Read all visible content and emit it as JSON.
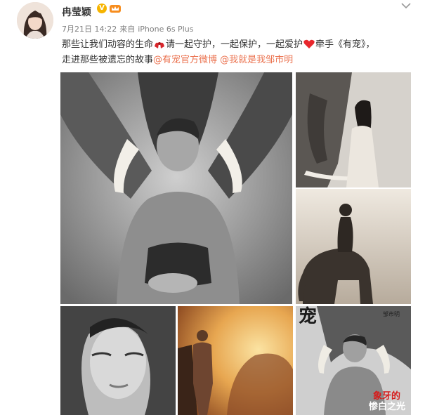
{
  "post": {
    "username": "冉莹颖",
    "verified_badge": "V",
    "timestamp": "7月21日 14:22",
    "source_prefix": "来自",
    "source_device": "iPhone 6s Plus",
    "text_part1": "那些让我们动容的生命",
    "text_part2": "请一起守护，一起保护，一起爱护",
    "text_part3": "牵手《有宠》，",
    "text_part4": "走进那些被遗忘的故事",
    "mention_1": "@有宠官方微博",
    "mention_2": "@我就是我邹市明"
  },
  "icons": {
    "avatar": "avatar",
    "verified": "verified-v-icon",
    "member": "crown-icon",
    "menu": "chevron-down-icon",
    "emoji_1": "red-bow-emoji",
    "emoji_2": "red-heart-emoji"
  },
  "colors": {
    "mention": "#eb7350",
    "username": "#333333",
    "meta": "#808080",
    "verified": "#f6b400"
  },
  "cover": {
    "title_char": "宠",
    "name_tag": "邹市明",
    "headline_red": "象牙的",
    "headline_white": "惨白之光"
  }
}
